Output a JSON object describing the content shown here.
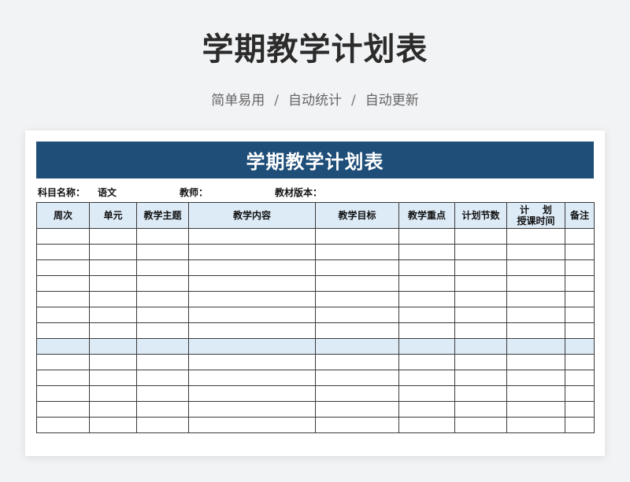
{
  "page": {
    "title": "学期教学计划表",
    "subtitle_items": [
      "简单易用",
      "自动统计",
      "自动更新"
    ],
    "separator": "/"
  },
  "sheet": {
    "title": "学期教学计划表",
    "info": {
      "subject_label": "科目名称：",
      "subject_value": "语文",
      "teacher_label": "教师：",
      "teacher_value": "",
      "textbook_label": "教材版本："
    },
    "columns": [
      "周次",
      "单元",
      "教学主题",
      "教学内容",
      "教学目标",
      "教学重点",
      "计划节数",
      "计    划",
      "备注"
    ],
    "column_sublabel": "授课时间",
    "rows": 13,
    "highlighted_row_index": 7
  },
  "colors": {
    "banner": "#1f4e79",
    "header_fill": "#ddebf7",
    "background": "#f2f3f5"
  }
}
